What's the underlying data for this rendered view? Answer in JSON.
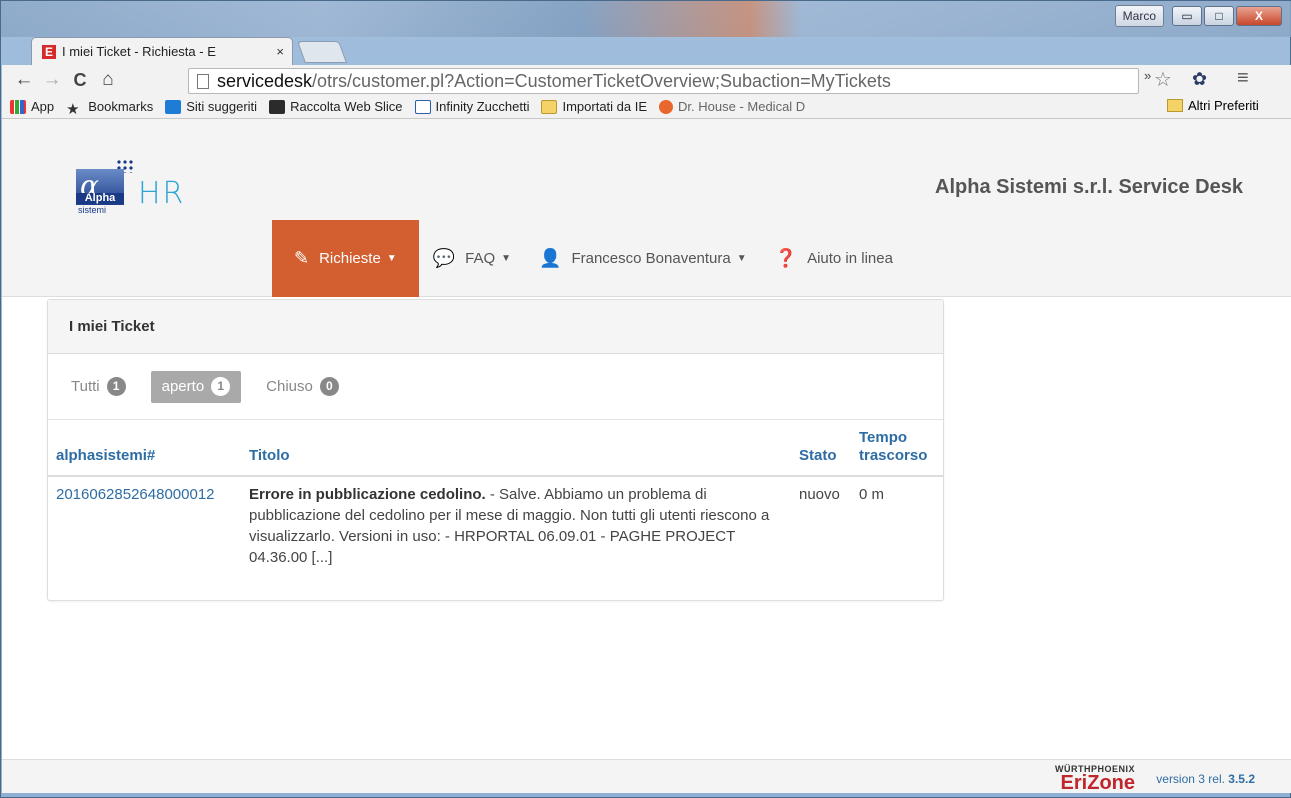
{
  "window": {
    "user": "Marco",
    "minimize": "▭",
    "maximize": "□",
    "close": "X"
  },
  "tab": {
    "favicon": "E",
    "title": "I miei Ticket - Richiesta - E",
    "close": "×"
  },
  "toolbar": {
    "back": "←",
    "forward": "→",
    "reload": "C",
    "home": "⌂",
    "url_host": "servicedesk",
    "url_path": "/otrs/customer.pl?Action=CustomerTicketOverview;Subaction=MyTickets",
    "bookmark_star": "☆",
    "extension": "✿",
    "menu": "≡"
  },
  "bookmarks": {
    "items": [
      {
        "label": "App",
        "icon": "apps-icon"
      },
      {
        "label": "Bookmarks",
        "icon": "star-icon"
      },
      {
        "label": "Siti suggeriti",
        "icon": "bing-icon"
      },
      {
        "label": "Raccolta Web Slice",
        "icon": "webslice-icon"
      },
      {
        "label": "Infinity Zucchetti",
        "icon": "page-icon"
      },
      {
        "label": "Importati da IE",
        "icon": "folder-icon"
      },
      {
        "label": "Dr. House - Medical D",
        "icon": "tv-icon"
      }
    ],
    "more": "»",
    "other": "Altri Preferiti"
  },
  "header": {
    "logo_alpha": "Alpha",
    "logo_sistemi": "sistemi",
    "logo_hr": "HR",
    "site_title": "Alpha Sistemi s.r.l. Service Desk"
  },
  "nav": {
    "requests": "Richieste",
    "faq": "FAQ",
    "user": "Francesco Bonaventura",
    "help": "Aiuto in linea"
  },
  "panel": {
    "title": "I miei Ticket",
    "filters": [
      {
        "label": "Tutti",
        "count": "1"
      },
      {
        "label": "aperto",
        "count": "1"
      },
      {
        "label": "Chiuso",
        "count": "0"
      }
    ],
    "columns": {
      "number": "alphasistemi#",
      "title": "Titolo",
      "state": "Stato",
      "age": "Tempo trascorso"
    },
    "rows": [
      {
        "number": "2016062852648000012",
        "title": "Errore in pubblicazione cedolino.",
        "excerpt": " - Salve. Abbiamo un problema di pubblicazione del cedolino per il mese di maggio. Non tutti gli utenti riescono a visualizzarlo. Versioni in uso: - HRPORTAL 06.09.01 - PAGHE PROJECT 04.36.00 [...]",
        "state": "nuovo",
        "age": "0 m"
      }
    ]
  },
  "footer": {
    "brand_top_a": "WÜRTH",
    "brand_top_b": "PHOENIX",
    "brand": "EriZone",
    "version_prefix": "version 3 rel. ",
    "version": "3.5.2"
  },
  "colors": {
    "accent": "#d35e2f",
    "link": "#2e6da4"
  }
}
